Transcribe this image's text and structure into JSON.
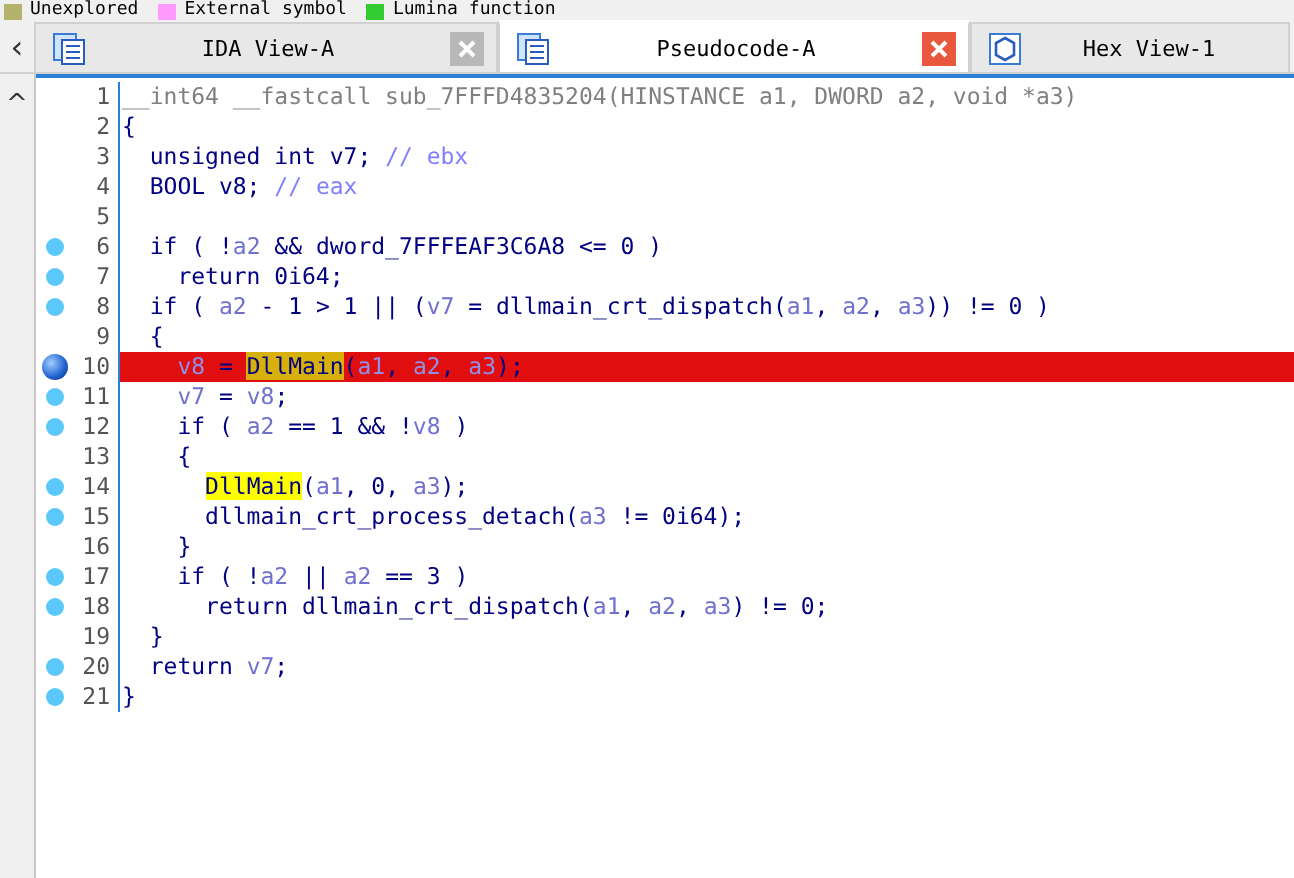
{
  "legend": [
    {
      "label": "Unexplored",
      "color": "#b3b36b"
    },
    {
      "label": "External symbol",
      "color": "#ff99ff"
    },
    {
      "label": "Lumina function",
      "color": "#33cc33"
    }
  ],
  "tabs": [
    {
      "label": "IDA View-A",
      "kind": "disasm",
      "selected": false,
      "closable": true
    },
    {
      "label": "Pseudocode-A",
      "kind": "pseudo",
      "selected": true,
      "closable": true
    },
    {
      "label": "Hex View-1",
      "kind": "hex",
      "selected": false,
      "closable": false
    }
  ],
  "nav": {
    "back": "‹",
    "up": "^"
  },
  "lines": [
    {
      "number": "1",
      "breakpoint": false,
      "current": false,
      "segments": [
        {
          "kind": "proto",
          "text": "__int64 __fastcall sub_7FFFD4835204(HINSTANCE a1, DWORD a2, void *a3)"
        }
      ]
    },
    {
      "number": "2",
      "breakpoint": false,
      "current": false,
      "segments": [
        {
          "kind": "plain",
          "text": "{"
        }
      ]
    },
    {
      "number": "3",
      "breakpoint": false,
      "current": false,
      "segments": [
        {
          "kind": "plain",
          "text": "  unsigned int v7; "
        },
        {
          "kind": "comment",
          "text": "// ebx"
        }
      ]
    },
    {
      "number": "4",
      "breakpoint": false,
      "current": false,
      "segments": [
        {
          "kind": "plain",
          "text": "  BOOL v8; "
        },
        {
          "kind": "comment",
          "text": "// eax"
        }
      ]
    },
    {
      "number": "5",
      "breakpoint": false,
      "current": false
    },
    {
      "number": "6",
      "breakpoint": true,
      "current": false,
      "segments": [
        {
          "kind": "plain",
          "text": "  if ( !"
        },
        {
          "kind": "var",
          "text": "a2"
        },
        {
          "kind": "plain",
          "text": " && dword_7FFFEAF3C6A8 <= 0 )"
        }
      ]
    },
    {
      "number": "7",
      "breakpoint": true,
      "current": false,
      "segments": [
        {
          "kind": "plain",
          "text": "    return 0i64;"
        }
      ]
    },
    {
      "number": "8",
      "breakpoint": true,
      "current": false,
      "segments": [
        {
          "kind": "plain",
          "text": "  if ( "
        },
        {
          "kind": "var",
          "text": "a2"
        },
        {
          "kind": "plain",
          "text": " - 1 > 1 || ("
        },
        {
          "kind": "var",
          "text": "v7"
        },
        {
          "kind": "plain",
          "text": " = dllmain_crt_dispatch("
        },
        {
          "kind": "var",
          "text": "a1"
        },
        {
          "kind": "plain",
          "text": ", "
        },
        {
          "kind": "var",
          "text": "a2"
        },
        {
          "kind": "plain",
          "text": ", "
        },
        {
          "kind": "var",
          "text": "a3"
        },
        {
          "kind": "plain",
          "text": ")) != 0 )"
        }
      ]
    },
    {
      "number": "9",
      "breakpoint": false,
      "current": false,
      "segments": [
        {
          "kind": "plain",
          "text": "  {"
        }
      ]
    },
    {
      "number": "10",
      "breakpoint": true,
      "current": true,
      "segments": [
        {
          "kind": "var",
          "text": "    v8"
        },
        {
          "kind": "plain",
          "text": " = "
        },
        {
          "kind": "match",
          "text": "DllMain"
        },
        {
          "kind": "plain",
          "text": "("
        },
        {
          "kind": "var",
          "text": "a1"
        },
        {
          "kind": "plain",
          "text": ", "
        },
        {
          "kind": "var",
          "text": "a2"
        },
        {
          "kind": "plain",
          "text": ", "
        },
        {
          "kind": "var",
          "text": "a3"
        },
        {
          "kind": "plain",
          "text": ");"
        }
      ]
    },
    {
      "number": "11",
      "breakpoint": true,
      "current": false,
      "segments": [
        {
          "kind": "var",
          "text": "    v7"
        },
        {
          "kind": "plain",
          "text": " = "
        },
        {
          "kind": "var",
          "text": "v8"
        },
        {
          "kind": "plain",
          "text": ";"
        }
      ]
    },
    {
      "number": "12",
      "breakpoint": true,
      "current": false,
      "segments": [
        {
          "kind": "plain",
          "text": "    if ( "
        },
        {
          "kind": "var",
          "text": "a2"
        },
        {
          "kind": "plain",
          "text": " == 1 && !"
        },
        {
          "kind": "var",
          "text": "v8"
        },
        {
          "kind": "plain",
          "text": " )"
        }
      ]
    },
    {
      "number": "13",
      "breakpoint": false,
      "current": false,
      "segments": [
        {
          "kind": "plain",
          "text": "    {"
        }
      ]
    },
    {
      "number": "14",
      "breakpoint": true,
      "current": false,
      "segments": [
        {
          "kind": "match",
          "text": "      DllMain"
        },
        {
          "kind": "plain",
          "text": "("
        },
        {
          "kind": "var",
          "text": "a1"
        },
        {
          "kind": "plain",
          "text": ", 0, "
        },
        {
          "kind": "var",
          "text": "a3"
        },
        {
          "kind": "plain",
          "text": ");"
        }
      ]
    },
    {
      "number": "15",
      "breakpoint": true,
      "current": false,
      "segments": [
        {
          "kind": "plain",
          "text": "      dllmain_crt_process_detach("
        },
        {
          "kind": "var",
          "text": "a3"
        },
        {
          "kind": "plain",
          "text": " != 0i64);"
        }
      ]
    },
    {
      "number": "16",
      "breakpoint": false,
      "current": false,
      "segments": [
        {
          "kind": "plain",
          "text": "    }"
        }
      ]
    },
    {
      "number": "17",
      "breakpoint": true,
      "current": false,
      "segments": [
        {
          "kind": "plain",
          "text": "    if ( !"
        },
        {
          "kind": "var",
          "text": "a2"
        },
        {
          "kind": "plain",
          "text": " || "
        },
        {
          "kind": "var",
          "text": "a2"
        },
        {
          "kind": "plain",
          "text": " == 3 )"
        }
      ]
    },
    {
      "number": "18",
      "breakpoint": true,
      "current": false,
      "segments": [
        {
          "kind": "plain",
          "text": "      return dllmain_crt_dispatch("
        },
        {
          "kind": "var",
          "text": "a1"
        },
        {
          "kind": "plain",
          "text": ", "
        },
        {
          "kind": "var",
          "text": "a2"
        },
        {
          "kind": "plain",
          "text": ", "
        },
        {
          "kind": "var",
          "text": "a3"
        },
        {
          "kind": "plain",
          "text": ") != 0;"
        }
      ]
    },
    {
      "number": "19",
      "breakpoint": false,
      "current": false,
      "segments": [
        {
          "kind": "plain",
          "text": "  }"
        }
      ]
    },
    {
      "number": "20",
      "breakpoint": true,
      "current": false,
      "segments": [
        {
          "kind": "plain",
          "text": "  return "
        },
        {
          "kind": "var",
          "text": "v7"
        },
        {
          "kind": "plain",
          "text": ";"
        }
      ]
    },
    {
      "number": "21",
      "breakpoint": true,
      "current": false,
      "segments": [
        {
          "kind": "plain",
          "text": "}"
        }
      ]
    }
  ]
}
